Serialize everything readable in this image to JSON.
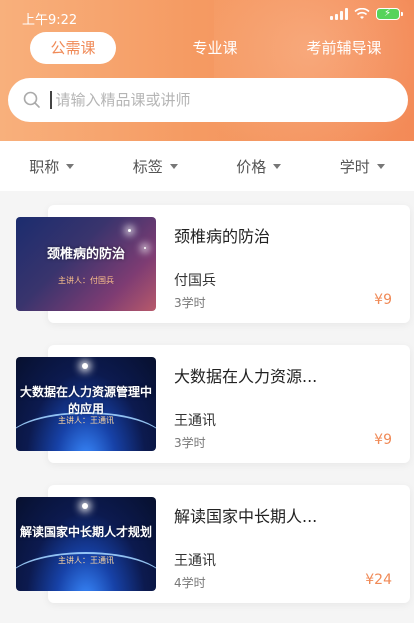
{
  "status": {
    "time": "上午9:22"
  },
  "tabs": [
    {
      "label": "公需课",
      "active": true
    },
    {
      "label": "专业课",
      "active": false
    },
    {
      "label": "考前辅导课",
      "active": false
    }
  ],
  "search": {
    "placeholder": "请输入精品课或讲师"
  },
  "filters": [
    {
      "label": "职称"
    },
    {
      "label": "标签"
    },
    {
      "label": "价格"
    },
    {
      "label": "学时"
    }
  ],
  "courses": [
    {
      "title": "颈椎病的防治",
      "lecturer": "付国兵",
      "hours": "3学时",
      "price": "¥9",
      "thumb_title": "颈椎病的防治",
      "thumb_speaker": "主讲人：付国兵"
    },
    {
      "title": "大数据在人力资源...",
      "lecturer": "王通讯",
      "hours": "3学时",
      "price": "¥9",
      "thumb_title": "大数据在人力资源管理中的应用",
      "thumb_speaker": "主讲人：王通讯"
    },
    {
      "title": "解读国家中长期人...",
      "lecturer": "王通讯",
      "hours": "4学时",
      "price": "¥24",
      "thumb_title": "解读国家中长期人才规划",
      "thumb_speaker": "主讲人：王通讯"
    }
  ],
  "colors": {
    "accent": "#f08a57",
    "header_start": "#f8b07c",
    "header_end": "#f38a57"
  }
}
